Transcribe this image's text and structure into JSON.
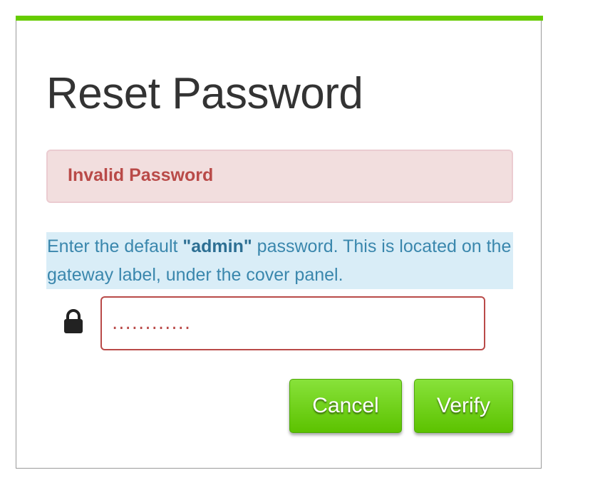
{
  "dialog": {
    "title": "Reset Password",
    "accent_color": "#66cc00"
  },
  "alert": {
    "text": "Invalid Password",
    "color": "#b94a48"
  },
  "info": {
    "prefix": "Enter the default ",
    "highlight": "\"admin\"",
    "suffix": " password. This is located on the gateway label, under the cover panel."
  },
  "password_field": {
    "icon": "lock-icon",
    "value": "............"
  },
  "buttons": {
    "cancel_label": "Cancel",
    "verify_label": "Verify"
  }
}
